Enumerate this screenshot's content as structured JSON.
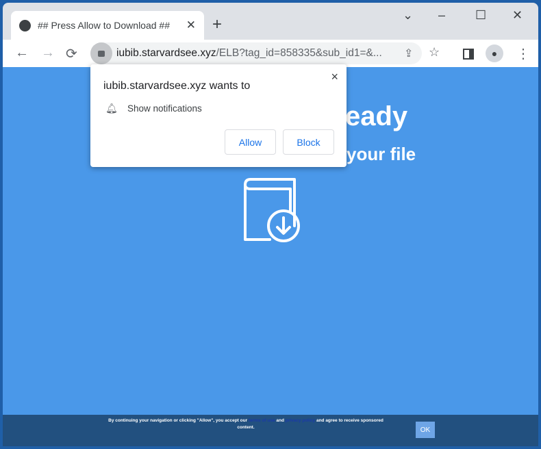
{
  "tab": {
    "title": "## Press Allow to Download ##"
  },
  "window": {
    "minimize": "–",
    "maximize": "☐",
    "close": "✕",
    "tabsearch": "⌄"
  },
  "address": {
    "host": "iubib.starvardsee.xyz",
    "path": "/ELB?tag_id=858335&sub_id1=&..."
  },
  "page": {
    "heading_fragment": "eady",
    "subheading_fragment": "your file",
    "footer": {
      "text1": "By continuing your navigation or clicking \"Allow\", you accept our",
      "link1": "terms of use",
      "and": "and",
      "link2": "privacy policy",
      "text2": "and agree to receive sponsored content.",
      "ok": "OK"
    }
  },
  "popup": {
    "title": "iubib.starvardsee.xyz wants to",
    "permission": "Show notifications",
    "allow": "Allow",
    "block": "Block",
    "close": "×"
  },
  "colors": {
    "page_bg": "#4a98e9",
    "footer_bg": "#22507f",
    "accent": "#1a73e8"
  }
}
